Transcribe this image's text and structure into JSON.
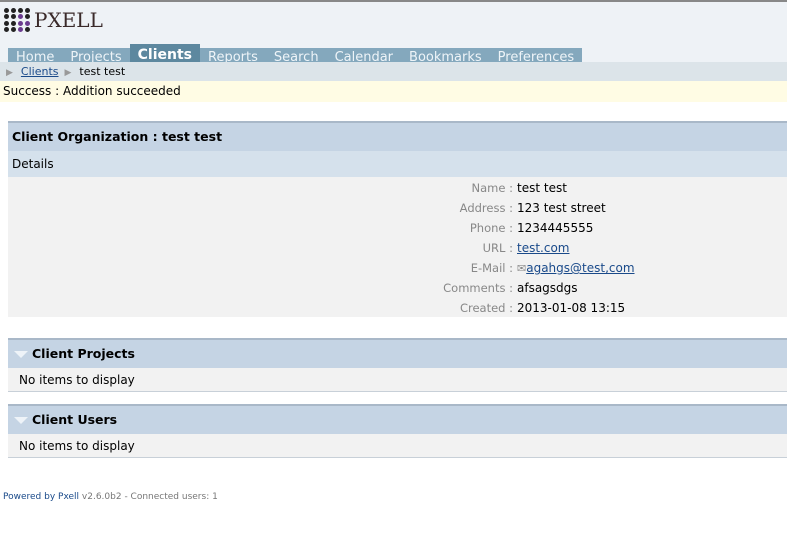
{
  "app": {
    "logo_text": "PXELL"
  },
  "nav": {
    "tabs": [
      {
        "label": "Home"
      },
      {
        "label": "Projects"
      },
      {
        "label": "Clients",
        "active": true
      },
      {
        "label": "Reports"
      },
      {
        "label": "Search"
      },
      {
        "label": "Calendar"
      },
      {
        "label": "Bookmarks"
      },
      {
        "label": "Preferences"
      }
    ]
  },
  "breadcrumb": {
    "link": "Clients",
    "current": "test test"
  },
  "message": {
    "label": "Success",
    "text": "Addition succeeded"
  },
  "client": {
    "title": "Client Organization : test test",
    "section": "Details",
    "fields": [
      {
        "label": "Name",
        "value": "test test"
      },
      {
        "label": "Address",
        "value": "123 test street"
      },
      {
        "label": "Phone",
        "value": "1234445555"
      },
      {
        "label": "URL",
        "value": "test.com"
      },
      {
        "label": "E-Mail",
        "value": "agahgs@test,com"
      },
      {
        "label": "Comments",
        "value": "afsagsdgs"
      },
      {
        "label": "Created",
        "value": "2013-01-08 13:15"
      }
    ]
  },
  "projects": {
    "title": "Client Projects",
    "empty": "No items to display"
  },
  "users": {
    "title": "Client Users",
    "empty": "No items to display"
  },
  "footer": {
    "powered": "Powered by Pxell",
    "version": "v2.6.0b2 - Connected users: 1"
  }
}
